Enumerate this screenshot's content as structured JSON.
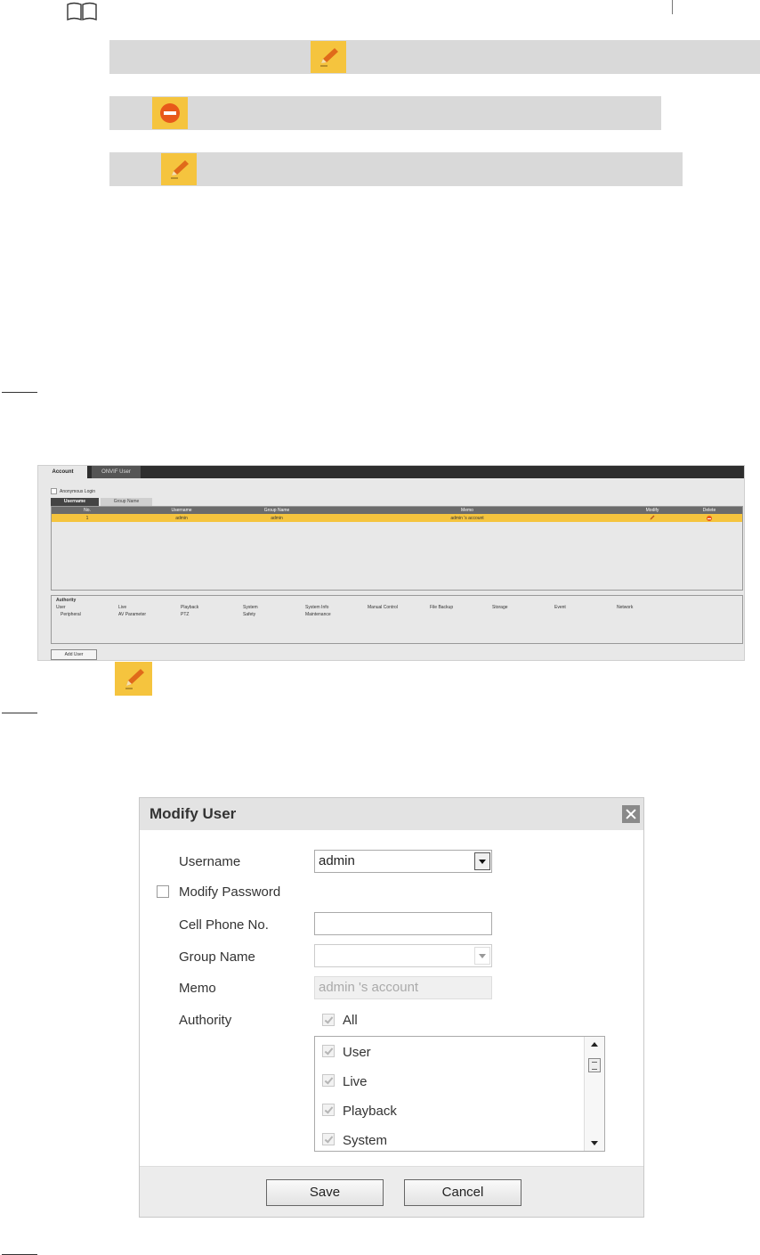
{
  "account_screen": {
    "tabs": [
      "Account",
      "ONVIF User"
    ],
    "anonymous_login": "Anonymous Login",
    "subtabs": [
      "Username",
      "Group Name"
    ],
    "columns": [
      "No.",
      "Username",
      "Group Name",
      "Memo",
      "Modify",
      "Delete"
    ],
    "rows": [
      {
        "no": "1",
        "username": "admin",
        "group": "admin",
        "memo": "admin 's account"
      }
    ],
    "authority_title": "Authority",
    "authority_items": [
      "User",
      "Live",
      "Playback",
      "System",
      "System Info",
      "Manual Control",
      "File Backup",
      "Storage",
      "Event",
      "Network",
      "Peripheral",
      "AV Parameter",
      "PTZ",
      "Safety",
      "Maintenance"
    ],
    "add_user_label": "Add User"
  },
  "dialog": {
    "title": "Modify User",
    "username_label": "Username",
    "username_value": "admin",
    "modify_password_label": "Modify Password",
    "cell_phone_label": "Cell Phone No.",
    "cell_phone_value": "",
    "group_name_label": "Group Name",
    "group_name_value": "",
    "memo_label": "Memo",
    "memo_value": "admin 's account",
    "authority_label": "Authority",
    "all_label": "All",
    "list_items": [
      "User",
      "Live",
      "Playback",
      "System"
    ],
    "save_label": "Save",
    "cancel_label": "Cancel"
  },
  "icons": {
    "note": "book-icon",
    "modify": "pencil-icon",
    "delete": "minus-circle-icon",
    "close": "close-icon"
  },
  "colors": {
    "highlight": "#f5c43e",
    "delete": "#e8591a",
    "note_bar": "#d9d9d9"
  }
}
